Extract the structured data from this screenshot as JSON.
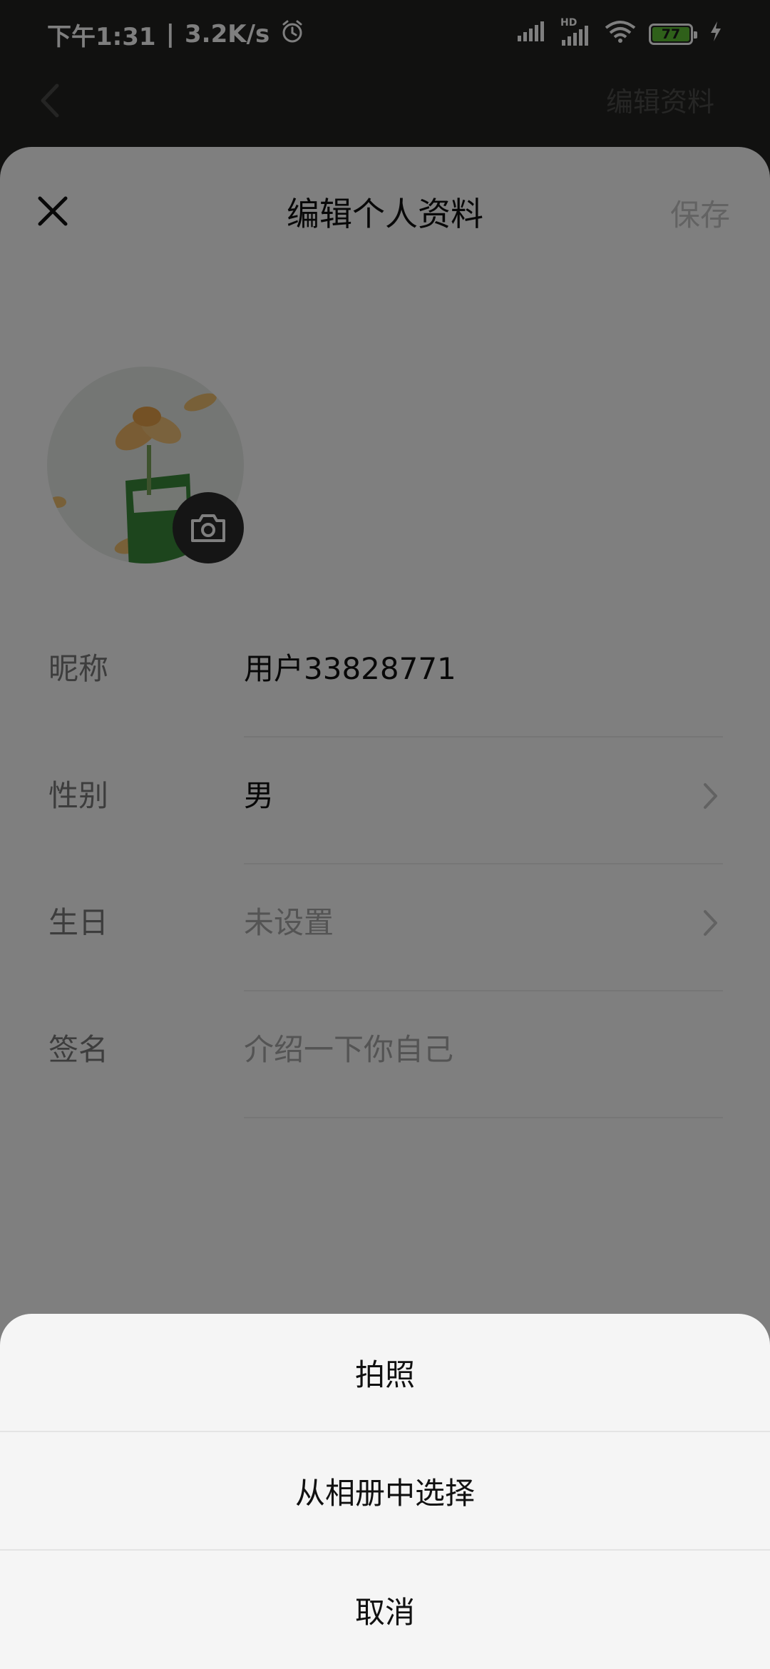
{
  "status_bar": {
    "time": "下午1:31",
    "net_speed": "3.2K/s",
    "hd_label": "HD",
    "battery_level": "77",
    "icons": [
      "alarm-icon",
      "signal-icon",
      "hd-signal-icon",
      "wifi-icon",
      "battery-icon",
      "charging-icon"
    ]
  },
  "underlay": {
    "title": "编辑资料"
  },
  "sheet": {
    "title": "编辑个人资料",
    "save_label": "保存",
    "fields": [
      {
        "label": "昵称",
        "value": "用户33828771",
        "placeholder": false,
        "chevron": false
      },
      {
        "label": "性别",
        "value": "男",
        "placeholder": false,
        "chevron": true
      },
      {
        "label": "生日",
        "value": "未设置",
        "placeholder": true,
        "chevron": true
      },
      {
        "label": "签名",
        "value": "介绍一下你自己",
        "placeholder": true,
        "chevron": false
      }
    ]
  },
  "action_sheet": {
    "items": [
      "拍照",
      "从相册中选择",
      "取消"
    ]
  },
  "colors": {
    "status_bg": "#222220",
    "overlay": "rgba(0,0,0,0.5)",
    "battery_green": "#5fc035",
    "action_bg": "#f5f5f5"
  }
}
